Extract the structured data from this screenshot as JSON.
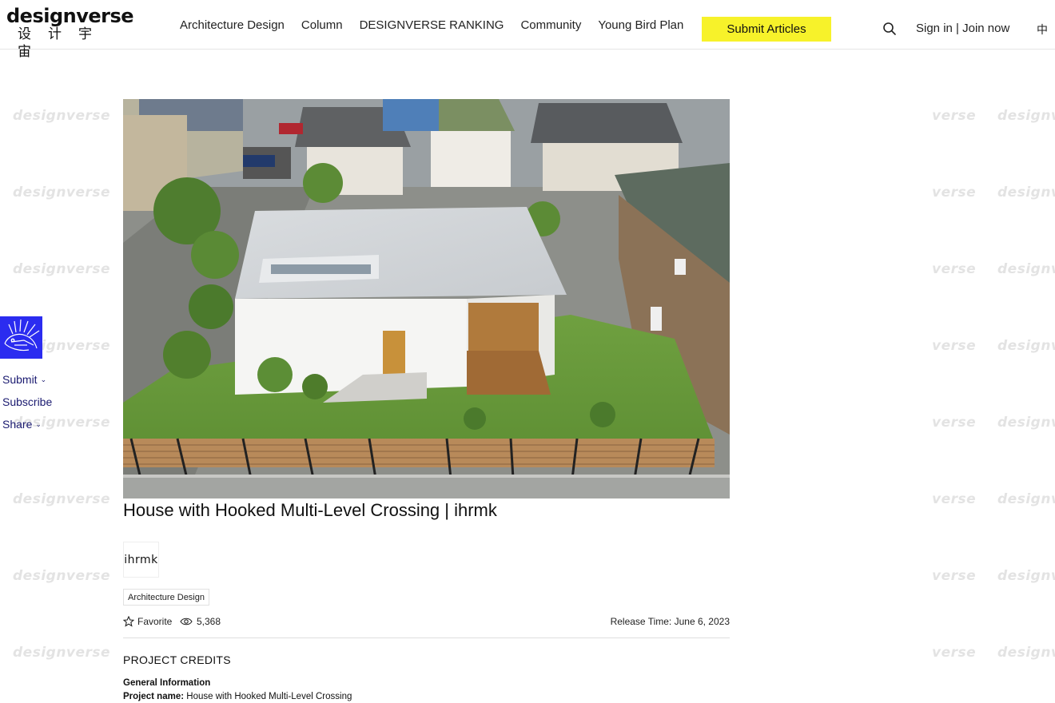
{
  "brand": {
    "logo_en": "designverse",
    "logo_cn": "设计宇宙",
    "watermark": "designverse"
  },
  "nav": {
    "items": [
      "Architecture Design",
      "Column",
      "DESIGNVERSE RANKING",
      "Community",
      "Young Bird Plan"
    ],
    "submit_label": "Submit Articles",
    "signin_label": "Sign in | Join now",
    "lang_label": "中"
  },
  "sidebar": {
    "submit_label": "Submit",
    "subscribe_label": "Subscribe",
    "share_label": "Share"
  },
  "article": {
    "title": "House with Hooked Multi-Level Crossing | ihrmk",
    "author_logo_text": "ihrmk",
    "tag": "Architecture Design",
    "favorite_label": "Favorite",
    "views": "5,368",
    "release_time": "Release Time: June 6, 2023",
    "credits_heading": "PROJECT CREDITS",
    "general_info_label": "General Information",
    "project_name_label": "Project name:",
    "project_name_value": "House with Hooked Multi-Level Crossing"
  },
  "colors": {
    "accent_yellow": "#f7f22a",
    "badge_blue": "#2b2cf0",
    "link_navy": "#1a1a70"
  }
}
